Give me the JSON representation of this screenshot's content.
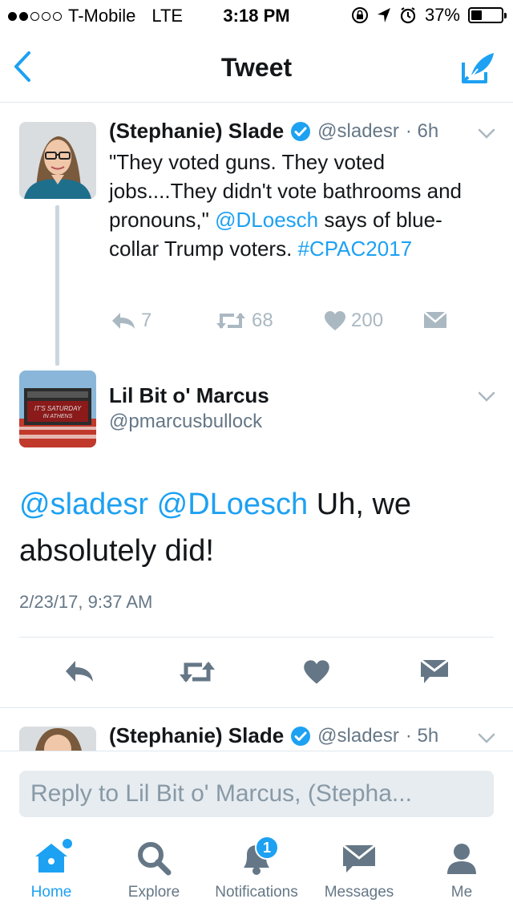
{
  "status_bar": {
    "carrier": "T-Mobile",
    "network": "LTE",
    "time": "3:18 PM",
    "battery": "37%",
    "battery_level": 0.37,
    "signal_bars_filled": 2,
    "signal_bars_total": 5
  },
  "nav": {
    "title": "Tweet",
    "back_icon": "chevron-left-icon",
    "compose_icon": "compose-tweet-icon"
  },
  "tweet1": {
    "name": "(Stephanie) Slade",
    "handle": "@sladesr",
    "age": "· 6h",
    "text_1": "\"They voted guns. They voted jobs....They didn't vote bathrooms and pronouns,\" ",
    "mention": "@DLoesch",
    "text_2": " says of blue-collar Trump voters. ",
    "hashtag": "#CPAC2017",
    "reply_count": "7",
    "retweet_count": "68",
    "like_count": "200"
  },
  "tweet2": {
    "name": "Lil Bit o' Marcus",
    "handle": "@pmarcusbullock",
    "mention_1": "@sladesr",
    "mention_2": "@DLoesch",
    "text": " Uh, we absolutely did!",
    "timestamp": "2/23/17, 9:37 AM"
  },
  "tweet3": {
    "name": "(Stephanie) Slade",
    "handle": "@sladesr",
    "age": "· 5h"
  },
  "reply": {
    "placeholder": "Reply to Lil Bit o' Marcus, (Stepha..."
  },
  "tabs": [
    {
      "label": "Home",
      "icon": "home-icon",
      "active": true
    },
    {
      "label": "Explore",
      "icon": "search-icon",
      "active": false
    },
    {
      "label": "Notifications",
      "icon": "bell-icon",
      "badge": "1",
      "active": false
    },
    {
      "label": "Messages",
      "icon": "envelope-icon",
      "active": false
    },
    {
      "label": "Me",
      "icon": "person-icon",
      "active": false
    }
  ],
  "colors": {
    "accent": "#1da1f2",
    "verified": "#1da1f2",
    "text": "#14171a",
    "muted": "#657786",
    "action_grey": "#aab8c2"
  }
}
